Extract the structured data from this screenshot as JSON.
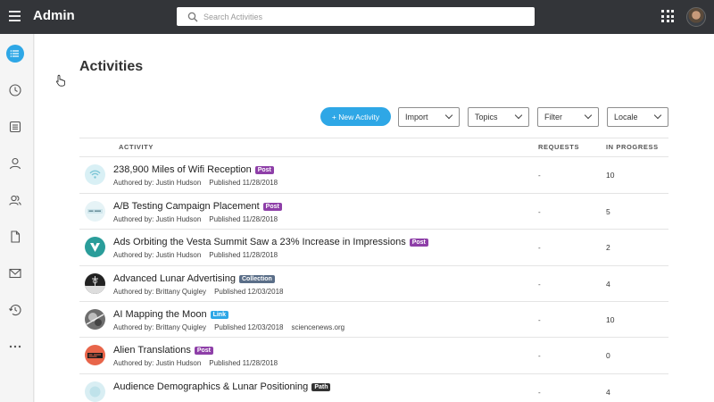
{
  "header": {
    "app_title": "Admin",
    "search_placeholder": "Search Activities"
  },
  "page": {
    "title": "Activities"
  },
  "toolbar": {
    "new_activity": "+ New Activity",
    "import": "Import",
    "topics": "Topics",
    "filter": "Filter",
    "locale": "Locale"
  },
  "table": {
    "columns": {
      "activity": "ACTIVITY",
      "requests": "REQUESTS",
      "in_progress": "IN PROGRESS"
    },
    "rows": [
      {
        "title": "238,900 Miles of Wifi Reception",
        "badge": "Post",
        "author": "Authored by: Justin Hudson",
        "published": "Published 11/28/2018",
        "source": "",
        "requests": "-",
        "in_progress": "10"
      },
      {
        "title": "A/B Testing Campaign Placement",
        "badge": "Post",
        "author": "Authored by: Justin Hudson",
        "published": "Published 11/28/2018",
        "source": "",
        "requests": "-",
        "in_progress": "5"
      },
      {
        "title": "Ads Orbiting the Vesta Summit Saw a 23% Increase in Impressions",
        "badge": "Post",
        "author": "Authored by: Justin Hudson",
        "published": "Published 11/28/2018",
        "source": "",
        "requests": "-",
        "in_progress": "2"
      },
      {
        "title": "Advanced Lunar Advertising",
        "badge": "Collection",
        "author": "Authored by: Brittany Quigley",
        "published": "Published 12/03/2018",
        "source": "",
        "requests": "-",
        "in_progress": "4"
      },
      {
        "title": "AI Mapping the Moon",
        "badge": "Link",
        "author": "Authored by: Brittany Quigley",
        "published": "Published 12/03/2018",
        "source": "sciencenews.org",
        "requests": "-",
        "in_progress": "10"
      },
      {
        "title": "Alien Translations",
        "badge": "Post",
        "author": "Authored by: Justin Hudson",
        "published": "Published 11/28/2018",
        "source": "",
        "requests": "-",
        "in_progress": "0"
      },
      {
        "title": "Audience Demographics & Lunar Positioning",
        "badge": "Path",
        "author": "",
        "published": "",
        "source": "",
        "requests": "-",
        "in_progress": "4"
      }
    ]
  },
  "colors": {
    "topbar": "#333539",
    "accent": "#2ea7e6",
    "badge_post": "#8e3fa8",
    "badge_collection": "#5a6e88",
    "badge_link": "#2ea7e6",
    "badge_path": "#333333"
  }
}
